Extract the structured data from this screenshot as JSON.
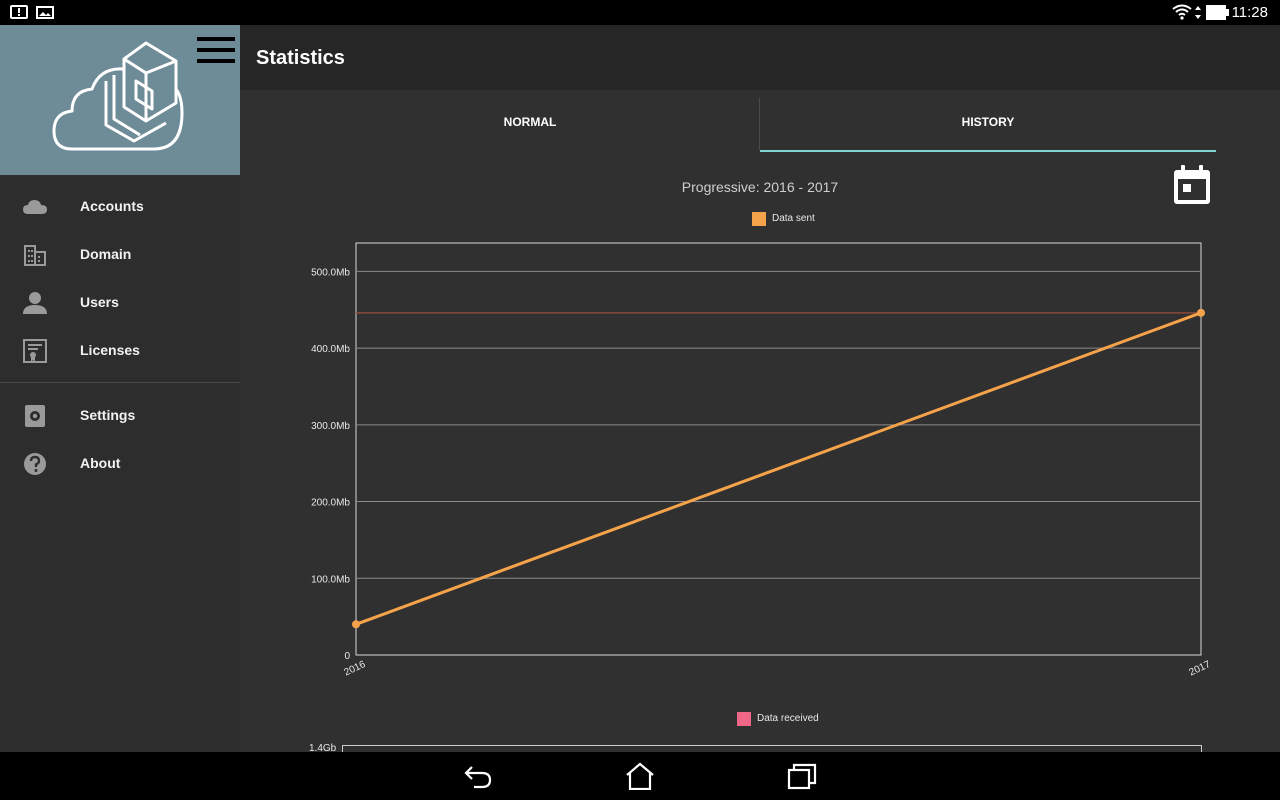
{
  "status_bar": {
    "time": "11:28",
    "left_icons": [
      "alert-icon",
      "image-icon"
    ],
    "right_icons": [
      "wifi-icon",
      "data-arrows-icon",
      "battery-icon"
    ]
  },
  "drawer": {
    "logo": "cloud-cube-logo",
    "menu_icon": "hamburger-menu-icon",
    "items": [
      {
        "label": "Accounts",
        "icon": "cloud-icon"
      },
      {
        "label": "Domain",
        "icon": "building-icon"
      },
      {
        "label": "Users",
        "icon": "person-icon"
      },
      {
        "label": "Licenses",
        "icon": "certificate-icon"
      },
      {
        "label": "Settings",
        "icon": "gear-icon"
      },
      {
        "label": "About",
        "icon": "help-icon"
      }
    ]
  },
  "appbar": {
    "title": "Statistics"
  },
  "tabs": [
    {
      "label": "NORMAL",
      "selected": false
    },
    {
      "label": "HISTORY",
      "selected": true
    }
  ],
  "calendar_icon": "calendar-icon",
  "colors": {
    "accent": "#7fd3d3",
    "data_sent": "#f5a34a",
    "data_received": "#f06686",
    "drawer_header": "#6e8b98",
    "limit_line": "#8a4a3a"
  },
  "chart_data": {
    "type": "line",
    "title": "Progressive: 2016 - 2017",
    "legend": "Data sent",
    "x": [
      "2016",
      "2017"
    ],
    "series": [
      {
        "name": "Data sent",
        "values": [
          40,
          446
        ]
      }
    ],
    "reference_line": 446,
    "yticks": [
      0,
      100,
      200,
      300,
      400,
      500
    ],
    "ytick_labels": [
      "0",
      "100.0Mb",
      "200.0Mb",
      "300.0Mb",
      "400.0Mb",
      "500.0Mb"
    ],
    "ylim": [
      0,
      537
    ],
    "grid": true
  },
  "second_chart": {
    "legend": "Data received",
    "first_tick_label": "1.4Gb"
  },
  "nav_bar": {
    "icons": [
      "back-icon",
      "home-icon",
      "recents-icon"
    ]
  }
}
